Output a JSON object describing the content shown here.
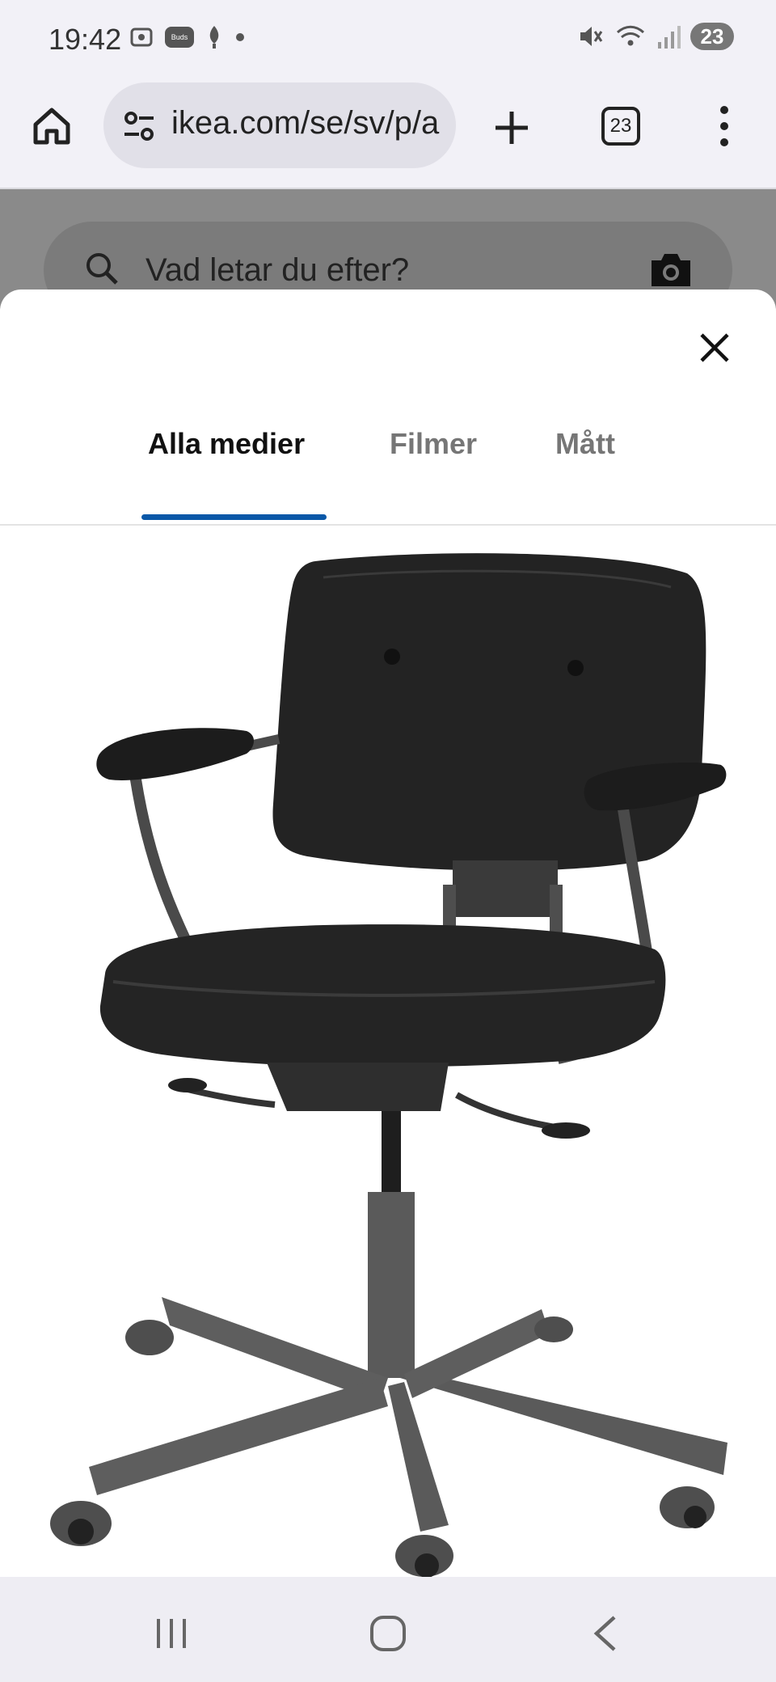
{
  "status_bar": {
    "time": "19:42",
    "left_icons": [
      "screenshot-icon",
      "buds-icon",
      "location-icon",
      "dot-icon"
    ],
    "buds_label": "Buds",
    "right_icons": [
      "mute-icon",
      "wifi-icon",
      "signal-icon"
    ],
    "battery": "23"
  },
  "browser": {
    "url": "ikea.com/se/sv/p/a",
    "tab_count": "23"
  },
  "background_page": {
    "search_placeholder": "Vad letar du efter?"
  },
  "media_modal": {
    "tabs": [
      {
        "label": "Alla medier",
        "active": true
      },
      {
        "label": "Filmer",
        "active": false
      },
      {
        "label": "Mått",
        "active": false
      }
    ],
    "accent_color": "#0a58a8",
    "image": "black-leather-office-chair"
  },
  "nav_bar": {
    "buttons": [
      "recents-icon",
      "home-icon",
      "back-icon"
    ]
  }
}
